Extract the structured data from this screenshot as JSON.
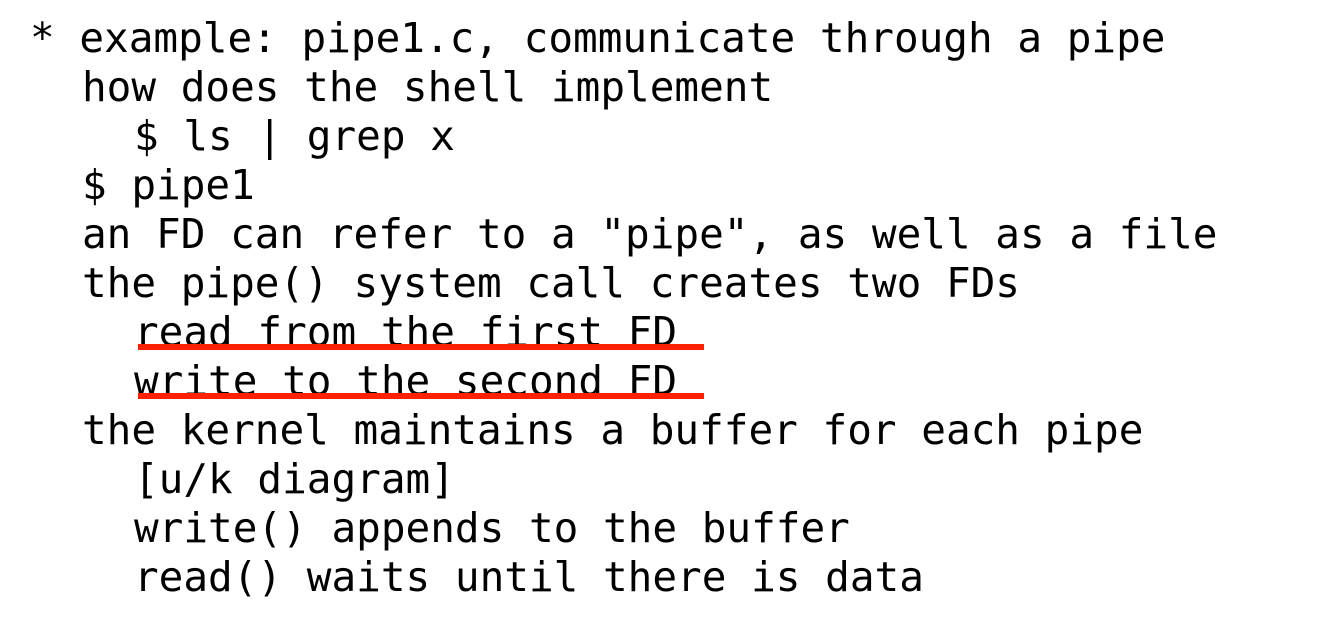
{
  "document": {
    "type": "plain-text-lecture-notes",
    "topic": "Unix pipes",
    "background_color": "#ffffff",
    "text_color": "#000000",
    "highlight_color": "#ff2200",
    "lines": [
      {
        "id": "l1",
        "text": "* example: pipe1.c, communicate through a pipe",
        "indent": 0,
        "underlined": false
      },
      {
        "id": "l2",
        "text": "how does the shell implement",
        "indent": 2,
        "underlined": false
      },
      {
        "id": "l3",
        "text": "$ ls | grep x",
        "indent": 4,
        "underlined": false
      },
      {
        "id": "l4",
        "text": "$ pipe1",
        "indent": 2,
        "underlined": false
      },
      {
        "id": "l5",
        "text": "an FD can refer to a \"pipe\", as well as a file",
        "indent": 2,
        "underlined": false
      },
      {
        "id": "l6",
        "text": "the pipe() system call creates two FDs",
        "indent": 2,
        "underlined": false
      },
      {
        "id": "l7",
        "text": "read from the first FD",
        "indent": 4,
        "underlined": true
      },
      {
        "id": "l8",
        "text": "write to the second FD",
        "indent": 4,
        "underlined": true
      },
      {
        "id": "l9",
        "text": "the kernel maintains a buffer for each pipe",
        "indent": 2,
        "underlined": false
      },
      {
        "id": "l10",
        "text": "[u/k diagram]",
        "indent": 4,
        "underlined": false
      },
      {
        "id": "l11",
        "text": "write() appends to the buffer",
        "indent": 4,
        "underlined": false
      },
      {
        "id": "l12",
        "text": "read() waits until there is data",
        "indent": 4,
        "underlined": false
      }
    ],
    "annotations": [
      {
        "id": "a1",
        "kind": "underline",
        "color": "#ff2200",
        "target_line": "l7",
        "label": "red-underline-read-from-first-fd"
      },
      {
        "id": "a2",
        "kind": "underline",
        "color": "#ff2200",
        "target_line": "l8",
        "label": "red-underline-write-to-second-fd"
      }
    ]
  }
}
